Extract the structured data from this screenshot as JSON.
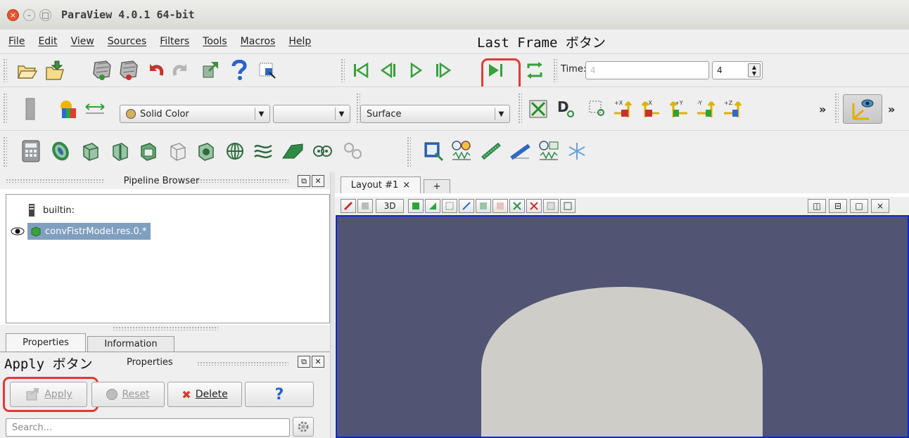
{
  "window": {
    "title": "ParaView 4.0.1 64-bit",
    "close_glyph": "×",
    "minimize_glyph": "–",
    "maximize_glyph": "□"
  },
  "menu": [
    "File",
    "Edit",
    "View",
    "Sources",
    "Filters",
    "Tools",
    "Macros",
    "Help"
  ],
  "annotations": {
    "last_frame": "Last Frame ボタン",
    "apply": "Apply ボタン",
    "highlight_color": "#e03a35"
  },
  "toolbar_time": {
    "label": "Time:",
    "value_placeholder": "4",
    "index_value": "4"
  },
  "toolbar_display": {
    "color_by": "Solid Color",
    "component": "",
    "representation": "Surface",
    "view_labels": [
      "+X",
      "-X",
      "+Y",
      "-Y",
      "+Z"
    ],
    "more": "»"
  },
  "pipeline": {
    "header": "Pipeline Browser",
    "items": [
      "builtin:",
      "convFistrModel.res.0.*"
    ],
    "selected_bg": "#7f9fbf"
  },
  "properties": {
    "tabs": [
      "Properties",
      "Information"
    ],
    "header": "Properties",
    "buttons": {
      "apply": "Apply",
      "reset": "Reset",
      "delete": "Delete",
      "help": "?"
    },
    "search_placeholder": "Search..."
  },
  "layout": {
    "tab_label": "Layout #1",
    "tab_close": "×",
    "add_tab": "+",
    "view_3d_label": "3D",
    "split_buttons": [
      "◫",
      "⊟",
      "□",
      "×"
    ]
  },
  "render_view": {
    "background": "#515472",
    "object_color": "#cfcdc8",
    "border_color": "#0a26d6"
  }
}
